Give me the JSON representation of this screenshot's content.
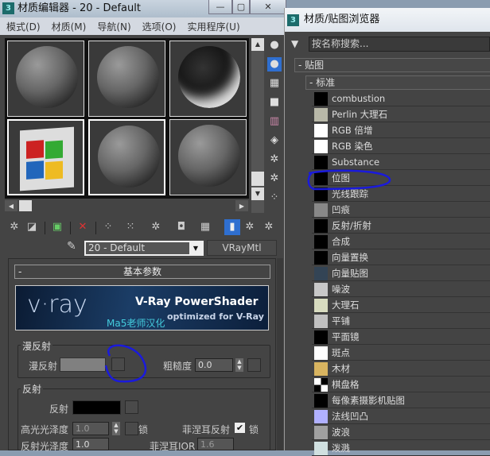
{
  "editor": {
    "title": "材质编辑器 - 20 - Default",
    "win_min": "—",
    "win_max": "▢",
    "win_close": "✕",
    "menu": [
      "模式(D)",
      "材质(M)",
      "导航(N)",
      "选项(O)",
      "实用程序(U)"
    ],
    "material_name": "20 - Default",
    "material_type": "VRayMtl",
    "rollout": "基本参数",
    "banner": {
      "logo": "v·ray",
      "title": "V-Ray PowerShader",
      "subtitle": "optimized for V-Ray",
      "credit": "Ma5老师汉化"
    },
    "diffuse": {
      "group": "漫反射",
      "label": "漫反射",
      "roughness_label": "粗糙度",
      "roughness": "0.0",
      "color": "#808080"
    },
    "reflection": {
      "group": "反射",
      "label": "反射",
      "color": "#000000",
      "hilight_label": "高光光泽度",
      "hilight": "1.0",
      "lock": "锁",
      "fresnel_label": "菲涅耳反射",
      "fresnel_checked": true,
      "gloss_label": "反射光泽度",
      "gloss": "1.0",
      "ior_label": "菲涅耳IOR",
      "ior": "1.6"
    }
  },
  "browser": {
    "title": "材质/贴图浏览器",
    "search_placeholder": "按名称搜索...",
    "section": "- 贴图",
    "subsection": "- 标准",
    "items": [
      {
        "label": "combustion",
        "swatch": "#000000"
      },
      {
        "label": "Perlin 大理石",
        "swatch": "#b8b8a8"
      },
      {
        "label": "RGB 倍增",
        "swatch": "#ffffff"
      },
      {
        "label": "RGB 染色",
        "swatch": "#ffffff"
      },
      {
        "label": "Substance",
        "swatch": "#000000"
      },
      {
        "label": "位图",
        "swatch": "#000000"
      },
      {
        "label": "光线跟踪",
        "swatch": "#000000"
      },
      {
        "label": "凹痕",
        "swatch": "#888888"
      },
      {
        "label": "反射/折射",
        "swatch": "#000000"
      },
      {
        "label": "合成",
        "swatch": "#000000"
      },
      {
        "label": "向量置换",
        "swatch": "#000000"
      },
      {
        "label": "向量贴图",
        "swatch": "#334455"
      },
      {
        "label": "噪波",
        "swatch": "#c8c8c8"
      },
      {
        "label": "大理石",
        "swatch": "#d8dcc0"
      },
      {
        "label": "平铺",
        "swatch": "#c0c0c0"
      },
      {
        "label": "平面镜",
        "swatch": "#000000"
      },
      {
        "label": "斑点",
        "swatch": "#ffffff"
      },
      {
        "label": "木材",
        "swatch": "#d8b460"
      },
      {
        "label": "棋盘格",
        "swatch": "#808080"
      },
      {
        "label": "每像素摄影机贴图",
        "swatch": "#000000"
      },
      {
        "label": "法线凹凸",
        "swatch": "#b0b0ff"
      },
      {
        "label": "波浪",
        "swatch": "#a0a0a0"
      },
      {
        "label": "泼溅",
        "swatch": "#d0e0e0"
      }
    ]
  },
  "annotation_color": "#1a1adc"
}
